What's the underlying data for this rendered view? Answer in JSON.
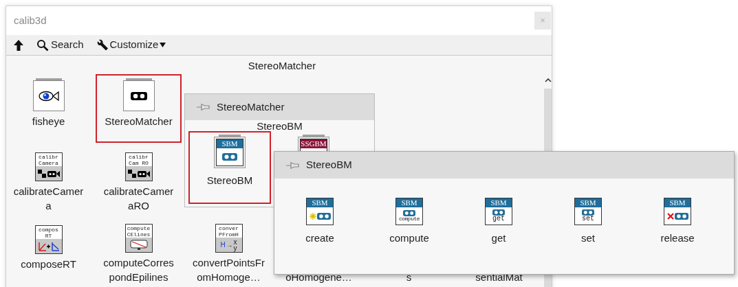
{
  "window": {
    "title": "calib3d",
    "close_label": "×"
  },
  "toolbar": [
    {
      "kind": "up"
    },
    {
      "kind": "search",
      "label": "Search"
    },
    {
      "kind": "customize",
      "label": "Customize"
    }
  ],
  "palette": {
    "heading": "StereoMatcher",
    "rows": [
      [
        {
          "kind": "item",
          "label": "fisheye",
          "icon": {
            "kind": "fisheye"
          },
          "selected": false
        },
        {
          "kind": "item",
          "label": "StereoMatcher",
          "icon": {
            "kind": "glasses"
          },
          "selected": true
        },
        {
          "kind": "covered"
        },
        {
          "kind": "covered"
        },
        {
          "kind": "covered"
        },
        {
          "kind": "covered"
        }
      ],
      [
        {
          "kind": "item",
          "label": "calibrateCamera",
          "icon": {
            "kind": "camera",
            "text": [
              "calibr",
              "Camera"
            ]
          },
          "selected": false
        },
        {
          "kind": "item",
          "label": "calibrateCameraRO",
          "icon": {
            "kind": "camera",
            "text": [
              "calibr",
              "Cam RO"
            ]
          },
          "selected": false
        },
        {
          "kind": "covered"
        },
        {
          "kind": "covered"
        },
        {
          "kind": "covered"
        },
        {
          "kind": "covered"
        }
      ],
      [
        {
          "kind": "item",
          "label": "composeRT",
          "icon": {
            "kind": "compose",
            "text": [
              "compos",
              "RT"
            ]
          },
          "selected": false
        },
        {
          "kind": "item",
          "label": "computeCorrespondEpilines",
          "icon": {
            "kind": "epilines",
            "text": [
              "compute",
              "CElines"
            ]
          },
          "selected": false
        },
        {
          "kind": "item",
          "label": "convertPointsFromHomoge…",
          "icon": {
            "kind": "convert",
            "text": [
              "conver",
              "PFromH"
            ],
            "formula": [
              "H",
              "→",
              "x",
              "y"
            ]
          },
          "selected": false
        },
        {
          "kind": "tail",
          "label": "oHomogene…"
        },
        {
          "kind": "tail",
          "label": "s"
        },
        {
          "kind": "tail",
          "label": "sentialMat"
        }
      ]
    ]
  },
  "submenu": {
    "title": "StereoMatcher",
    "heading": "StereoBM",
    "items": [
      {
        "label": "StereoBM",
        "icon": {
          "kind": "sbm",
          "text": [
            "SBM"
          ]
        },
        "selected": true
      },
      {
        "icon": {
          "kind": "ssgbm",
          "text": [
            "SSGBM"
          ]
        },
        "selected": false
      }
    ]
  },
  "methods": {
    "title": "StereoBM",
    "items": [
      {
        "label": "create",
        "icon": {
          "kind": "create",
          "text": [
            "SBM"
          ]
        }
      },
      {
        "label": "compute",
        "icon": {
          "kind": "compute",
          "text": [
            "SBM",
            "compute"
          ]
        }
      },
      {
        "label": "get",
        "icon": {
          "kind": "get",
          "text": [
            "SBM",
            "get"
          ]
        }
      },
      {
        "label": "set",
        "icon": {
          "kind": "set",
          "text": [
            "SBM",
            "set"
          ]
        }
      },
      {
        "label": "release",
        "icon": {
          "kind": "release",
          "text": [
            "SBM"
          ]
        }
      }
    ]
  }
}
